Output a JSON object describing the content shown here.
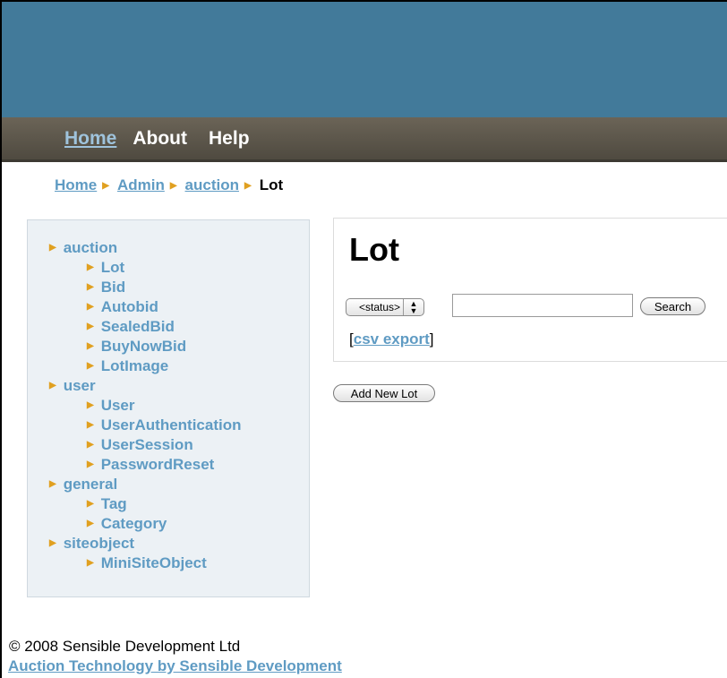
{
  "nav": {
    "home": "Home",
    "about": "About",
    "help": "Help"
  },
  "breadcrumb": {
    "home": "Home",
    "admin": "Admin",
    "auction": "auction",
    "current": "Lot"
  },
  "sidebar": {
    "groups": [
      {
        "label": "auction",
        "items": [
          "Lot",
          "Bid",
          "Autobid",
          "SealedBid",
          "BuyNowBid",
          "LotImage"
        ]
      },
      {
        "label": "user",
        "items": [
          "User",
          "UserAuthentication",
          "UserSession",
          "PasswordReset"
        ]
      },
      {
        "label": "general",
        "items": [
          "Tag",
          "Category"
        ]
      },
      {
        "label": "siteobject",
        "items": [
          "MiniSiteObject"
        ]
      }
    ]
  },
  "main": {
    "title": "Lot",
    "status_select": "<status>",
    "search_value": "",
    "search_button": "Search",
    "csv_open": "[",
    "csv_label": "csv export",
    "csv_close": "]",
    "add_button": "Add New Lot"
  },
  "footer": {
    "copyright": "© 2008 Sensible Development Ltd",
    "link": "Auction Technology by Sensible Development"
  },
  "colors": {
    "header": "#427a9a",
    "navbar": "#5a544a",
    "link": "#5f9bc3",
    "arrow": "#e0a020",
    "sidebar_bg": "#ecf1f5"
  }
}
